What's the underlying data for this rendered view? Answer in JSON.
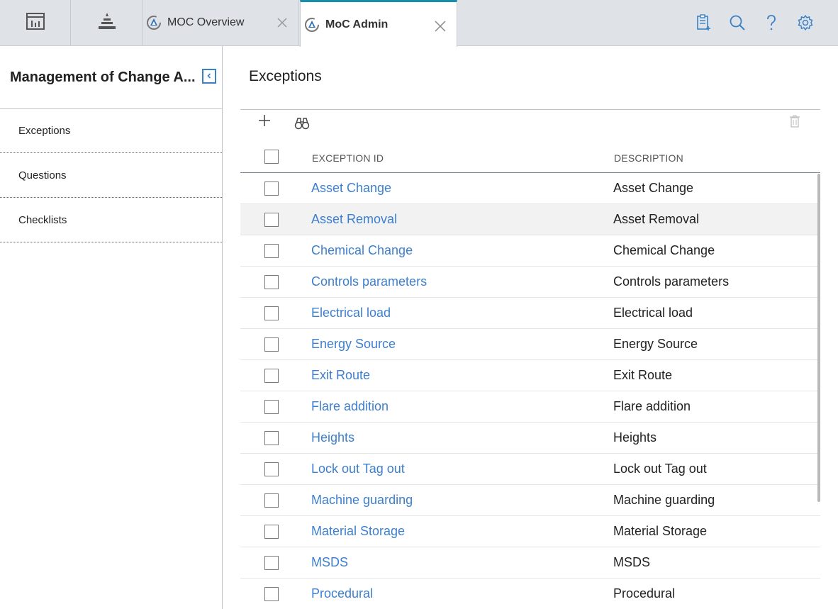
{
  "tabs": {
    "dashboard_icon": "dashboard-icon",
    "hierarchy_icon": "hierarchy-icon",
    "moc_overview": {
      "label": "MOC Overview",
      "icon": "moc-icon",
      "close": "×"
    },
    "moc_admin": {
      "label": "MoC Admin",
      "icon": "moc-icon",
      "close": "×"
    }
  },
  "top_actions": [
    "clipboard-icon",
    "search-icon",
    "help-icon",
    "gear-icon"
  ],
  "sidebar": {
    "title": "Management of Change A...",
    "items": [
      {
        "label": "Exceptions"
      },
      {
        "label": "Questions"
      },
      {
        "label": "Checklists"
      }
    ]
  },
  "main": {
    "title": "Exceptions",
    "toolbar": {
      "add_icon": "plus-icon",
      "find_icon": "binoculars-icon",
      "delete_icon": "trash-icon"
    },
    "grid": {
      "columns": [
        "EXCEPTION ID",
        "DESCRIPTION"
      ],
      "rows": [
        {
          "id": "Asset Change",
          "description": "Asset Change"
        },
        {
          "id": "Asset Removal",
          "description": "Asset Removal"
        },
        {
          "id": "Chemical Change",
          "description": "Chemical Change"
        },
        {
          "id": "Controls parameters",
          "description": "Controls parameters"
        },
        {
          "id": "Electrical load",
          "description": "Electrical load"
        },
        {
          "id": "Energy Source",
          "description": "Energy Source"
        },
        {
          "id": "Exit Route",
          "description": "Exit Route"
        },
        {
          "id": "Flare addition",
          "description": "Flare addition"
        },
        {
          "id": "Heights",
          "description": "Heights"
        },
        {
          "id": "Lock out Tag out",
          "description": "Lock out Tag out"
        },
        {
          "id": "Machine guarding",
          "description": "Machine guarding"
        },
        {
          "id": "Material Storage",
          "description": "Material Storage"
        },
        {
          "id": "MSDS",
          "description": "MSDS"
        },
        {
          "id": "Procedural",
          "description": "Procedural"
        }
      ]
    }
  },
  "colors": {
    "accent": "#1a8cab",
    "link": "#3d7fcf",
    "icon_blue": "#3b82c4"
  }
}
